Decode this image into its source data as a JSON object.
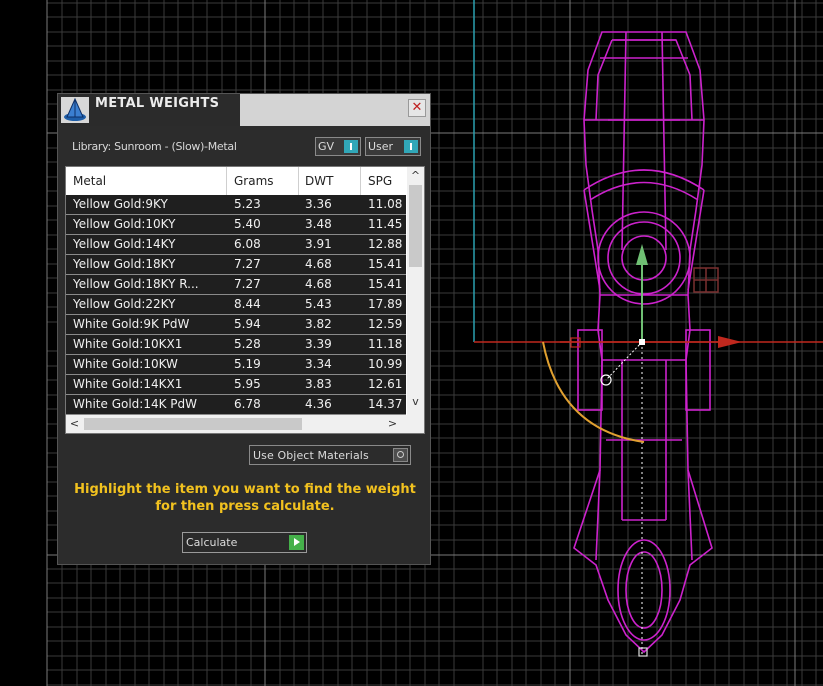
{
  "window": {
    "title": "METAL WEIGHTS",
    "close_glyph": "✕",
    "logo_icon": "metal-weights-logo-icon"
  },
  "library": {
    "label": "Library: Sunroom - (Slow)-Metal"
  },
  "toggles": {
    "gv": "GV",
    "user": "User"
  },
  "table": {
    "columns": [
      "Metal",
      "Grams",
      "DWT",
      "SPG"
    ],
    "rows": [
      [
        "Yellow Gold:9KY",
        "5.23",
        "3.36",
        "11.08"
      ],
      [
        "Yellow Gold:10KY",
        "5.40",
        "3.48",
        "11.45"
      ],
      [
        "Yellow Gold:14KY",
        "6.08",
        "3.91",
        "12.88"
      ],
      [
        "Yellow Gold:18KY",
        "7.27",
        "4.68",
        "15.41"
      ],
      [
        "Yellow Gold:18KY R...",
        "7.27",
        "4.68",
        "15.41"
      ],
      [
        "Yellow Gold:22KY",
        "8.44",
        "5.43",
        "17.89"
      ],
      [
        "White Gold:9K PdW",
        "5.94",
        "3.82",
        "12.59"
      ],
      [
        "White Gold:10KX1",
        "5.28",
        "3.39",
        "11.18"
      ],
      [
        "White Gold:10KW",
        "5.19",
        "3.34",
        "10.99"
      ],
      [
        "White Gold:14KX1",
        "5.95",
        "3.83",
        "12.61"
      ],
      [
        "White Gold:14K PdW",
        "6.78",
        "4.36",
        "14.37"
      ]
    ],
    "scroll_up": "^",
    "scroll_down": "v",
    "scroll_left": "<",
    "scroll_right": ">"
  },
  "use_object_materials": {
    "label": "Use Object Materials"
  },
  "hint": "Highlight the item you want to find the weight for then press calculate.",
  "calculate": {
    "label": "Calculate"
  },
  "colors": {
    "wireframe": "#cc22cc",
    "gizmo_x": "#c0281e",
    "gizmo_y": "#6fbf73",
    "rotate_arc": "#e0a030",
    "hint_text": "#f2c21f",
    "accent": "#31a7b8"
  }
}
